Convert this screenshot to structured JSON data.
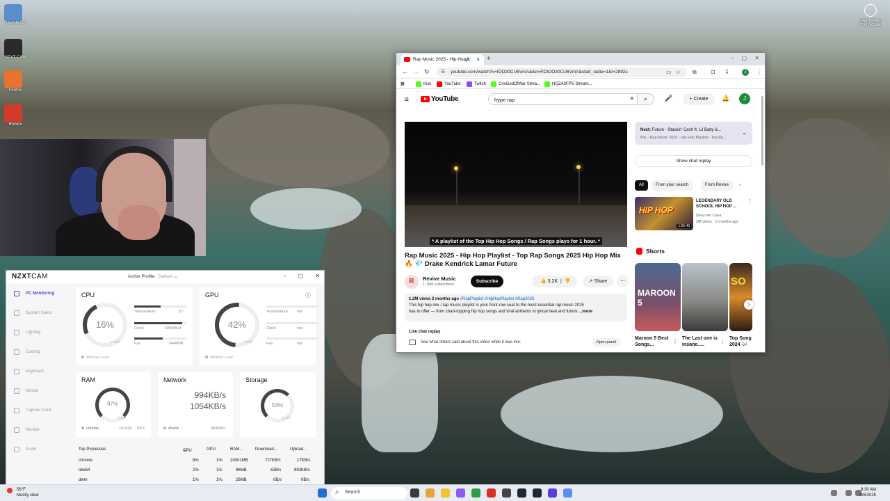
{
  "desktop": {
    "icons": [
      {
        "label": "Recycle Bin",
        "color": "#5a8fc8"
      },
      {
        "label": "NZXT CAM",
        "color": "#2a2a2a"
      },
      {
        "label": "Firefox",
        "color": "#e8732e"
      },
      {
        "label": "Roblox",
        "color": "#d23a2a"
      }
    ],
    "learn_about": "Learn about this picture"
  },
  "browser": {
    "tab_title": "Rap Music 2025 - Hip Hop",
    "url": "youtube.com/watch?v=IOO30CU6VmA&list=RDIOO30CU6VmA&start_radio=1&t=2892s",
    "bookmarks": [
      {
        "label": "Kick",
        "color": "#53fc18"
      },
      {
        "label": "YouTube",
        "color": "#ff0000"
      },
      {
        "label": "Twitch",
        "color": "#9146ff"
      },
      {
        "label": "CrisGodOfWar Strea...",
        "color": "#53fc18"
      },
      {
        "label": "HQZA0FPS Stream...",
        "color": "#53fc18"
      }
    ]
  },
  "youtube": {
    "logo": "YouTube",
    "search_value": "hype rap",
    "create_label": "Create",
    "avatar_letter": "J",
    "video_caption": "* A playlist of the Top Hip Hop Songs / Rap Songs plays for 1 hour. *",
    "video_title_1": "Rap Music 2025 - Hip Hop Playlist - Top Rap Songs 2025 Hip Hop Mix",
    "video_title_2": "🔥 💎 Drake Kendrick Lamar Future",
    "channel_name": "Revive Music",
    "channel_subs": "1.16M subscribers",
    "subscribe_label": "Subscribe",
    "likes": "3.2K",
    "share_label": "Share",
    "desc_meta": "1.2M views  2 months ago",
    "desc_tags": "#RapPlaylist #HipHopPlaylist #Rap2025",
    "desc_line1": "This hip hop mix / rap music playlist is your front-row seat to the most essential rap music 2025",
    "desc_line2": "has to offer — from chart-topping hip hop songs and viral anthems to lyrical heat and futuris",
    "desc_more": "...more",
    "live_chat_title": "Live chat replay",
    "live_chat_desc": "See what others said about this video while it was live.",
    "open_panel": "Open panel",
    "next_label": "Next:",
    "next_title": "Future - Stackin' Cash ft. Lil Baby &...",
    "next_sub": "Mix - Rap Music 2025 - Hip Hop Playlist - Top Ra...",
    "show_chat": "Show chat replay",
    "chips": [
      "All",
      "From your search",
      "From Revive"
    ],
    "rec": {
      "thumb_text": "HIP HOP",
      "duration": "1:55:48",
      "title": "LEGENDARY OLD SCHOOL HIP HOP ...",
      "channel": "Deus em Casa",
      "views": "2M views · 9 months ago"
    },
    "shorts_label": "Shorts",
    "shorts": [
      {
        "title": "Maroon 5 Best Songs...",
        "thumb": "MAROON 5"
      },
      {
        "title": "The Last one is insane.....",
        "thumb": ""
      },
      {
        "title": "Top Song 2024 🎶",
        "thumb": "SO"
      }
    ]
  },
  "cam": {
    "logo_a": "NZXT",
    "logo_b": "CAM",
    "profile_label": "Active Profile:",
    "profile_value": "Default",
    "sidebar": [
      "PC Monitoring",
      "System Specs",
      "Lighting",
      "Cooling",
      "Keyboard",
      "Mouse",
      "Capture Card",
      "Monitor",
      "Audio"
    ],
    "cpu": {
      "title": "CPU",
      "load": "16%",
      "load_label": "Load",
      "temp_label": "Temperature",
      "temp": "51°",
      "clock_label": "Clock",
      "clock": "5050MHz",
      "fan_label": "Fan",
      "fan": "744RPM",
      "status": "Minimal Load"
    },
    "gpu": {
      "title": "GPU",
      "load": "42%",
      "load_label": "Load",
      "temp_label": "Temperature",
      "temp": "n/a",
      "clock_label": "Clock",
      "clock": "n/a",
      "fan_label": "Fan",
      "fan": "n/a",
      "status": "Minimal Load"
    },
    "ram": {
      "title": "RAM",
      "load": "97%",
      "load_label": "Load",
      "proc": "chrome",
      "val1": "19.5GB",
      "val2": "63%"
    },
    "network": {
      "title": "Network",
      "down": "994KB/s",
      "up": "1054KB/s",
      "proc": "obs64",
      "val": "993KB/s"
    },
    "storage": {
      "title": "Storage",
      "load": "53%",
      "load_label": "Load"
    },
    "table": {
      "headers": [
        "Top Processes",
        "CPU",
        "GPU",
        "RAM...",
        "Download...",
        "Upload..."
      ],
      "rows": [
        [
          "chrome",
          "8%",
          "1%",
          "20001MB",
          "727KB/s",
          "17KB/s"
        ],
        [
          "obs64",
          "2%",
          "1%",
          "96MB",
          "62B/s",
          "993KB/s"
        ],
        [
          "dwm",
          "1%",
          "1%",
          "26MB",
          "0B/s",
          "0B/s"
        ]
      ]
    }
  },
  "taskbar": {
    "weather_temp": "56°F",
    "weather_desc": "Mostly clear",
    "search": "Search",
    "time": "9:30 AM",
    "date": "9/6/2025"
  }
}
